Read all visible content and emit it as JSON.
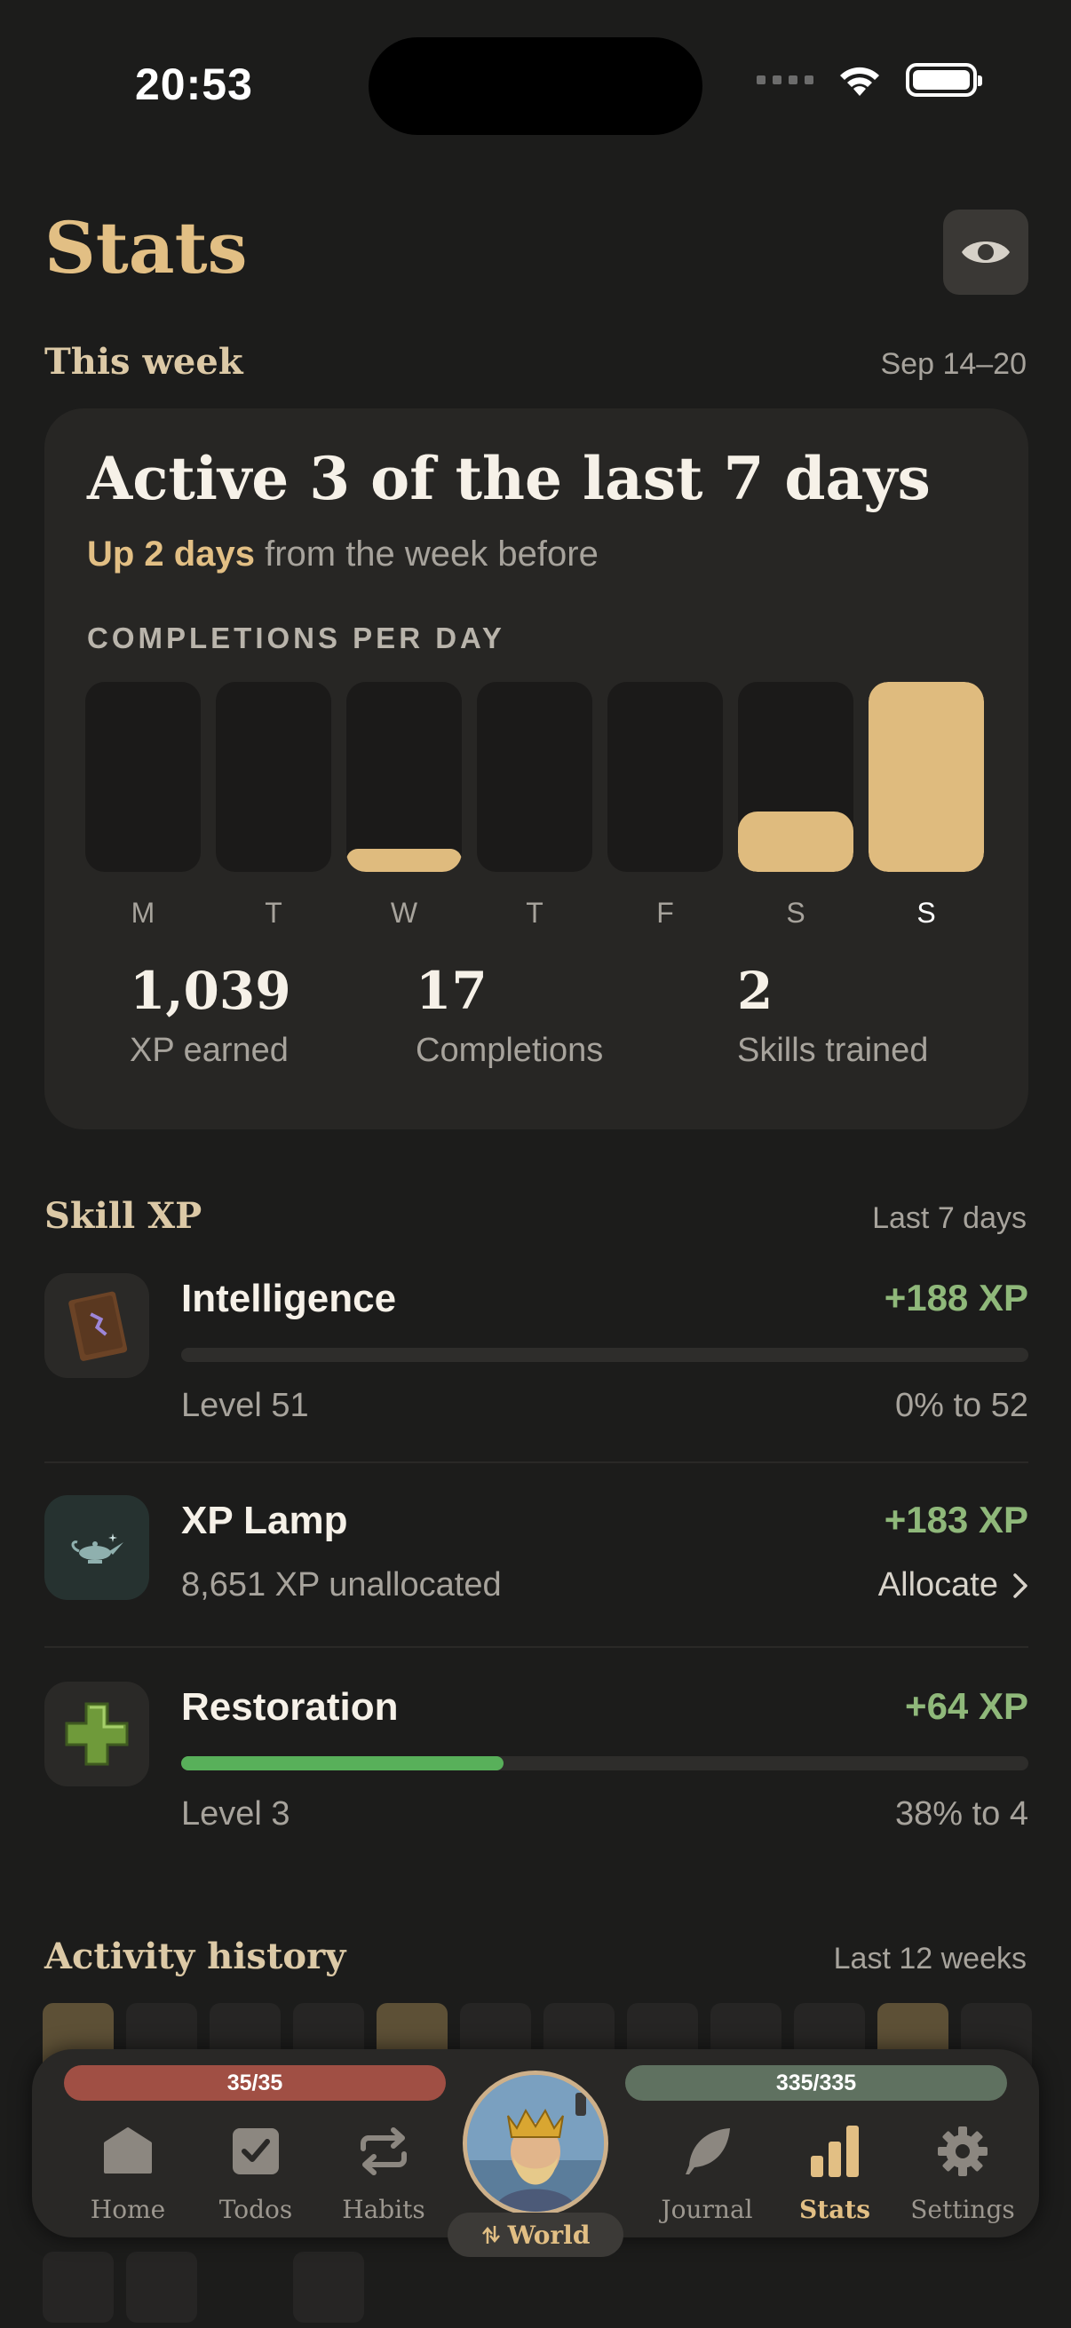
{
  "status": {
    "time": "20:53"
  },
  "header": {
    "title": "Stats",
    "eye_icon": "eye-icon"
  },
  "this_week": {
    "section_title": "This week",
    "date_range": "Sep 14–20",
    "headline": "Active 3 of the last 7 days",
    "delta_accent": "Up 2 days",
    "delta_rest": " from the week before",
    "chart_label": "COMPLETIONS PER DAY",
    "days": [
      {
        "label": "M",
        "fill": 0
      },
      {
        "label": "T",
        "fill": 0
      },
      {
        "label": "W",
        "fill": 0.12
      },
      {
        "label": "T",
        "fill": 0
      },
      {
        "label": "F",
        "fill": 0
      },
      {
        "label": "S",
        "fill": 0.32
      },
      {
        "label": "S",
        "fill": 1.0
      }
    ],
    "stats": [
      {
        "value": "1,039",
        "label": "XP earned"
      },
      {
        "value": "17",
        "label": "Completions"
      },
      {
        "value": "2",
        "label": "Skills trained"
      }
    ]
  },
  "skill_xp": {
    "section_title": "Skill XP",
    "range": "Last 7 days",
    "items": [
      {
        "name": "Intelligence",
        "xp": "+188 XP",
        "meta": "Level 51",
        "meta_right": "0% to 52",
        "progress": 0.0,
        "icon": "spellbook-icon"
      },
      {
        "name": "XP Lamp",
        "xp": "+183 XP",
        "meta": "8,651 XP unallocated",
        "action": "Allocate",
        "icon": "genie-lamp-icon"
      },
      {
        "name": "Restoration",
        "xp": "+64 XP",
        "meta": "Level 3",
        "meta_right": "38% to 4",
        "progress": 0.38,
        "icon": "green-cross-icon"
      }
    ]
  },
  "activity": {
    "section_title": "Activity history",
    "range": "Last 12 weeks"
  },
  "nav": {
    "hp": "35/35",
    "mp": "335/335",
    "world": "World",
    "items": [
      {
        "label": "Home",
        "icon": "home-icon"
      },
      {
        "label": "Todos",
        "icon": "checkbox-icon"
      },
      {
        "label": "Habits",
        "icon": "repeat-icon"
      },
      {
        "label": "Journal",
        "icon": "feather-icon"
      },
      {
        "label": "Stats",
        "icon": "bar-chart-icon"
      },
      {
        "label": "Settings",
        "icon": "gear-icon"
      }
    ],
    "active": "Stats"
  },
  "colors": {
    "accent": "#e2bf84",
    "xp_green": "#8fb87a",
    "progress_green": "#58b05a",
    "hp_red": "#a04f44",
    "mp_green": "#5f7160"
  }
}
